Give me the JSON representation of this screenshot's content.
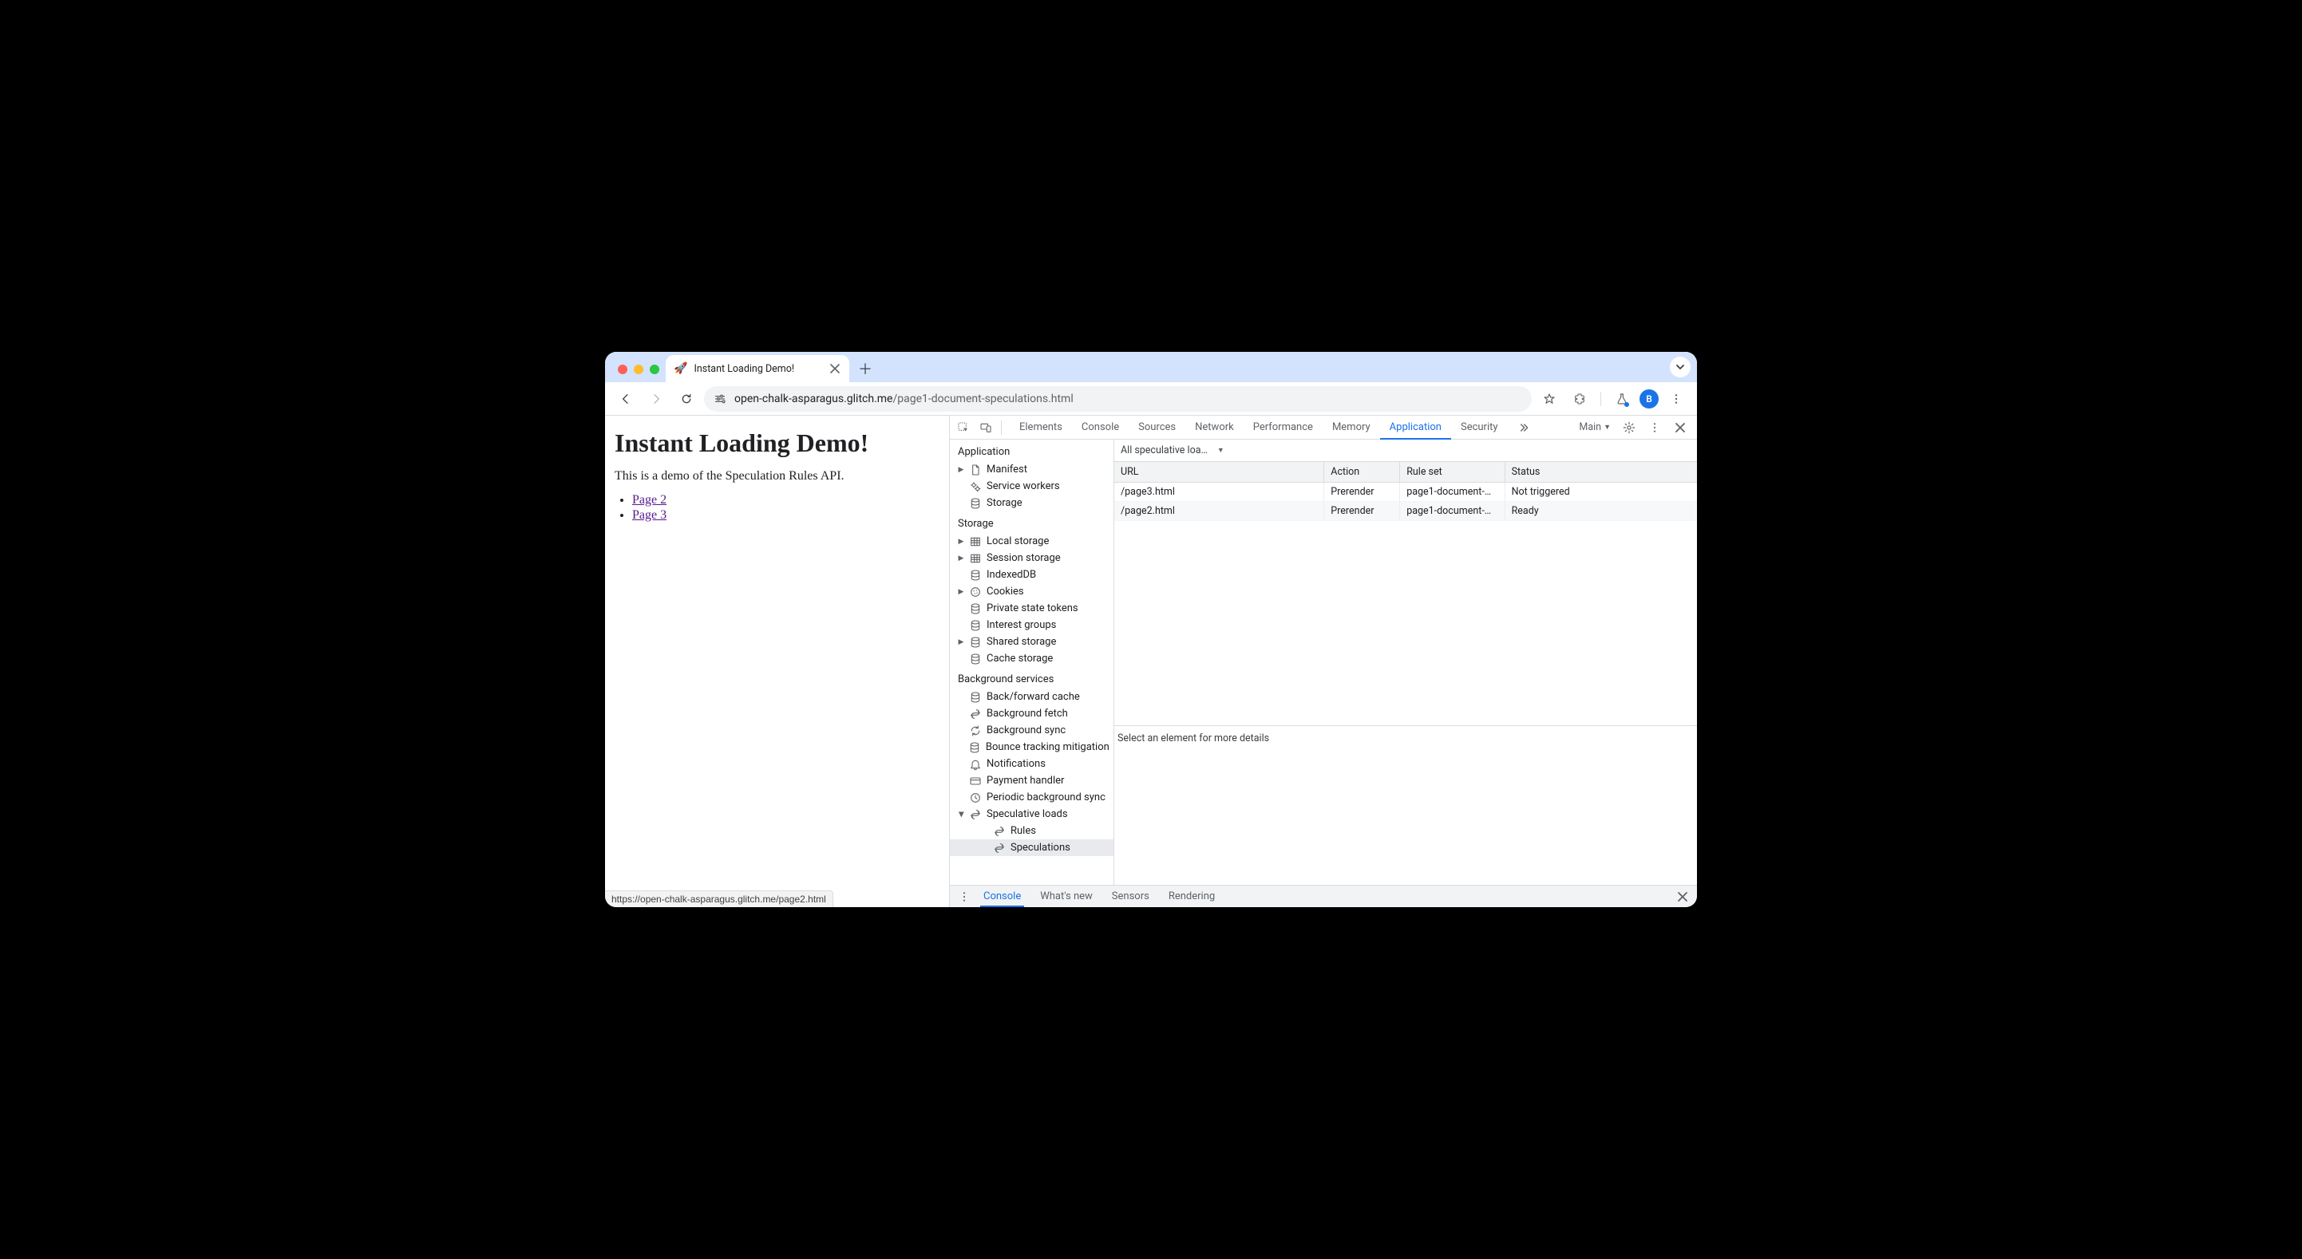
{
  "browser": {
    "tab": {
      "favicon": "🚀",
      "title": "Instant Loading Demo!"
    },
    "url_host": "open-chalk-asparagus.glitch.me",
    "url_path": "/page1-document-speculations.html",
    "avatar_letter": "B",
    "status_url": "https://open-chalk-asparagus.glitch.me/page2.html"
  },
  "page": {
    "heading": "Instant Loading Demo!",
    "intro": "This is a demo of the Speculation Rules API.",
    "links": [
      "Page 2",
      "Page 3"
    ]
  },
  "devtools": {
    "tabs": [
      "Elements",
      "Console",
      "Sources",
      "Network",
      "Performance",
      "Memory",
      "Application",
      "Security"
    ],
    "active_tab": "Application",
    "target_label": "Main",
    "sidebar": {
      "groups": [
        {
          "title": "Application",
          "items": [
            {
              "label": "Manifest",
              "icon": "file",
              "arrow": "right",
              "depth": 1
            },
            {
              "label": "Service workers",
              "icon": "gears",
              "arrow": "none",
              "depth": 1
            },
            {
              "label": "Storage",
              "icon": "db",
              "arrow": "none",
              "depth": 1
            }
          ]
        },
        {
          "title": "Storage",
          "items": [
            {
              "label": "Local storage",
              "icon": "grid",
              "arrow": "right",
              "depth": 1
            },
            {
              "label": "Session storage",
              "icon": "grid",
              "arrow": "right",
              "depth": 1
            },
            {
              "label": "IndexedDB",
              "icon": "db",
              "arrow": "none",
              "depth": 1
            },
            {
              "label": "Cookies",
              "icon": "cookie",
              "arrow": "right",
              "depth": 1
            },
            {
              "label": "Private state tokens",
              "icon": "db",
              "arrow": "none",
              "depth": 1
            },
            {
              "label": "Interest groups",
              "icon": "db",
              "arrow": "none",
              "depth": 1
            },
            {
              "label": "Shared storage",
              "icon": "db",
              "arrow": "right",
              "depth": 1
            },
            {
              "label": "Cache storage",
              "icon": "db",
              "arrow": "none",
              "depth": 1
            }
          ]
        },
        {
          "title": "Background services",
          "items": [
            {
              "label": "Back/forward cache",
              "icon": "db",
              "arrow": "none",
              "depth": 1
            },
            {
              "label": "Background fetch",
              "icon": "sync",
              "arrow": "none",
              "depth": 1
            },
            {
              "label": "Background sync",
              "icon": "sync2",
              "arrow": "none",
              "depth": 1
            },
            {
              "label": "Bounce tracking mitigation",
              "icon": "db",
              "arrow": "none",
              "depth": 1
            },
            {
              "label": "Notifications",
              "icon": "bell",
              "arrow": "none",
              "depth": 1
            },
            {
              "label": "Payment handler",
              "icon": "card",
              "arrow": "none",
              "depth": 1
            },
            {
              "label": "Periodic background sync",
              "icon": "clock",
              "arrow": "none",
              "depth": 1
            },
            {
              "label": "Speculative loads",
              "icon": "sync",
              "arrow": "down",
              "depth": 1
            },
            {
              "label": "Rules",
              "icon": "sync",
              "arrow": "none",
              "depth": 2
            },
            {
              "label": "Speculations",
              "icon": "sync",
              "arrow": "none",
              "depth": 2,
              "selected": true
            }
          ]
        }
      ]
    },
    "filter_label": "All speculative loa…",
    "table": {
      "columns": [
        "URL",
        "Action",
        "Rule set",
        "Status"
      ],
      "rows": [
        {
          "url": "/page3.html",
          "action": "Prerender",
          "ruleset": "page1-document-…",
          "status": "Not triggered"
        },
        {
          "url": "/page2.html",
          "action": "Prerender",
          "ruleset": "page1-document-…",
          "status": "Ready"
        }
      ]
    },
    "detail_hint": "Select an element for more details",
    "drawer_tabs": [
      "Console",
      "What's new",
      "Sensors",
      "Rendering"
    ],
    "drawer_active": "Console"
  }
}
